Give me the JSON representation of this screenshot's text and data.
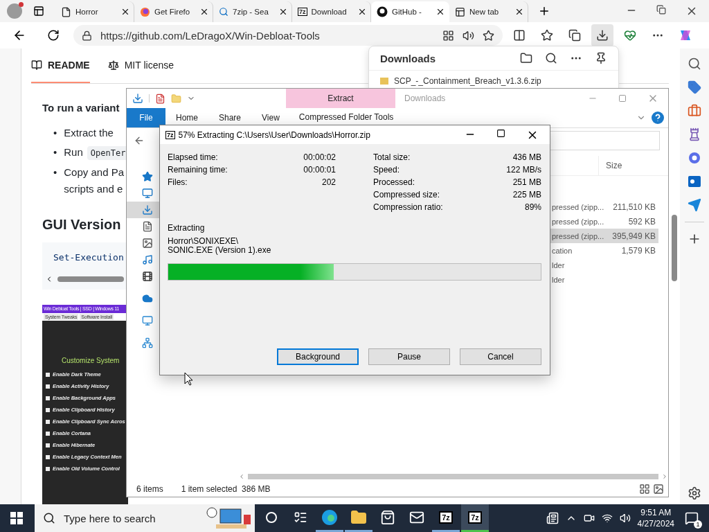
{
  "browser": {
    "tabs": [
      {
        "kind": "page",
        "title": "Horror",
        "selected": false
      },
      {
        "kind": "firefox",
        "title": "Get Firefo",
        "selected": false
      },
      {
        "kind": "search",
        "title": "7zip - Sea",
        "selected": false
      },
      {
        "kind": "sevenzip",
        "icon_text": "7z",
        "title": "Download",
        "selected": false
      },
      {
        "kind": "github",
        "title": "GitHub -",
        "selected": true
      },
      {
        "kind": "newtab",
        "title": "New tab",
        "selected": false
      }
    ],
    "url": "https://github.com/LeDragoX/Win-Debloat-Tools"
  },
  "page": {
    "tabs": [
      {
        "label": "README",
        "selected": true
      },
      {
        "label": "MIT license",
        "selected": false
      }
    ],
    "intro": "To run a variant",
    "bullets": [
      {
        "marker": "•",
        "text": "Extract the"
      },
      {
        "marker": "•",
        "text": "Run",
        "code": "OpenTer"
      },
      {
        "marker": "•",
        "lines": [
          "Copy and Pa",
          "scripts and e"
        ]
      }
    ],
    "heading": "GUI Version",
    "code": "Set-Execution",
    "screenshot": {
      "title": "Win Debloat Tools | SSD | Windows 11",
      "tabs": [
        "System Tweaks",
        "Software Install"
      ],
      "heading": "Customize System",
      "items": [
        "Enable Dark Theme",
        "Enable Activity History",
        "Enable Background Apps",
        "Enable Clipboard History",
        "Enable Clipboard Sync Acros",
        "Enable Cortana",
        "Enable Hibernate",
        "Enable Legacy Context Men",
        "Enable Old Volume Control"
      ]
    }
  },
  "downloads_panel": {
    "title": "Downloads",
    "items": [
      "SCP_-_Containment_Breach_v1.3.6.zip"
    ]
  },
  "explorer": {
    "title": "Downloads",
    "context_tab": "Extract",
    "ribbon_tabs": [
      {
        "label": "File",
        "kind": "file",
        "selected": false
      },
      {
        "label": "Home",
        "kind": "tab",
        "selected": false
      },
      {
        "label": "Share",
        "kind": "tab",
        "selected": false
      },
      {
        "label": "View",
        "kind": "tab",
        "selected": false
      },
      {
        "label": "Compressed Folder Tools",
        "kind": "context",
        "selected": false
      }
    ],
    "nav_groups": [
      [
        {
          "kind": "quick",
          "selected": false
        },
        {
          "kind": "desktop",
          "selected": false
        },
        {
          "kind": "downloads",
          "selected": true
        },
        {
          "kind": "documents",
          "selected": false
        },
        {
          "kind": "pictures",
          "selected": false
        },
        {
          "kind": "music",
          "selected": false
        },
        {
          "kind": "videos",
          "selected": false
        }
      ],
      [
        {
          "kind": "onedrive",
          "selected": false
        }
      ],
      [
        {
          "kind": "pc",
          "selected": false
        }
      ],
      [
        {
          "kind": "network",
          "selected": false
        }
      ]
    ],
    "column": "Size",
    "rows": [
      {
        "type": "pressed (zipp...",
        "size": "211,510 KB",
        "selected": false
      },
      {
        "type": "pressed (zipp...",
        "size": "592 KB",
        "selected": false
      },
      {
        "type": "pressed (zipp...",
        "size": "395,949 KB",
        "selected": true
      },
      {
        "type": "cation",
        "size": "1,579 KB",
        "selected": false
      },
      {
        "type": "lder",
        "selected": false
      },
      {
        "type": "lder",
        "selected": false
      }
    ],
    "status": [
      "6 items",
      "1 item selected  386 MB"
    ]
  },
  "extract_dialog": {
    "icon_text": "7z",
    "title": "57% Extracting C:\\Users\\User\\Downloads\\Horror.zip",
    "left_stats": [
      {
        "label": "Elapsed time:",
        "value": "00:00:02"
      },
      {
        "label": "Remaining time:",
        "value": "00:00:01"
      },
      {
        "label": "Files:",
        "value": "202"
      }
    ],
    "right_stats": [
      {
        "label": "Total size:",
        "value": "436 MB"
      },
      {
        "label": "Speed:",
        "value": "122 MB/s"
      },
      {
        "label": "Processed:",
        "value": "251 MB"
      },
      {
        "label": "Compressed size:",
        "value": "225 MB"
      },
      {
        "label": "Compression ratio:",
        "value": "89%"
      }
    ],
    "action": "Extracting",
    "path": [
      "Horror\\SONIXEXE\\",
      "SONIC.EXE (Version 1).exe"
    ],
    "level": 0.445,
    "buttons": [
      {
        "label": "Background",
        "focused": true
      },
      {
        "label": "Pause",
        "focused": false
      },
      {
        "label": "Cancel",
        "focused": false
      }
    ]
  },
  "taskbar": {
    "search_placeholder": "Type here to search",
    "apps": [
      {
        "kind": "cortana",
        "running": false,
        "selected": false
      },
      {
        "kind": "taskview",
        "running": false,
        "selected": false
      },
      {
        "kind": "edge",
        "running": true,
        "selected": false
      },
      {
        "kind": "explorer",
        "running": true,
        "selected": false
      },
      {
        "kind": "store",
        "running": false,
        "selected": false
      },
      {
        "kind": "mail",
        "running": false,
        "selected": false
      },
      {
        "kind": "sevenzip",
        "icon_text": "7z",
        "running": true,
        "selected": false
      },
      {
        "kind": "sevenzip",
        "icon_text": "7z",
        "running": true,
        "selected": true
      }
    ],
    "time": "9:51 AM",
    "date": "4/27/2024",
    "notifications": "1"
  }
}
